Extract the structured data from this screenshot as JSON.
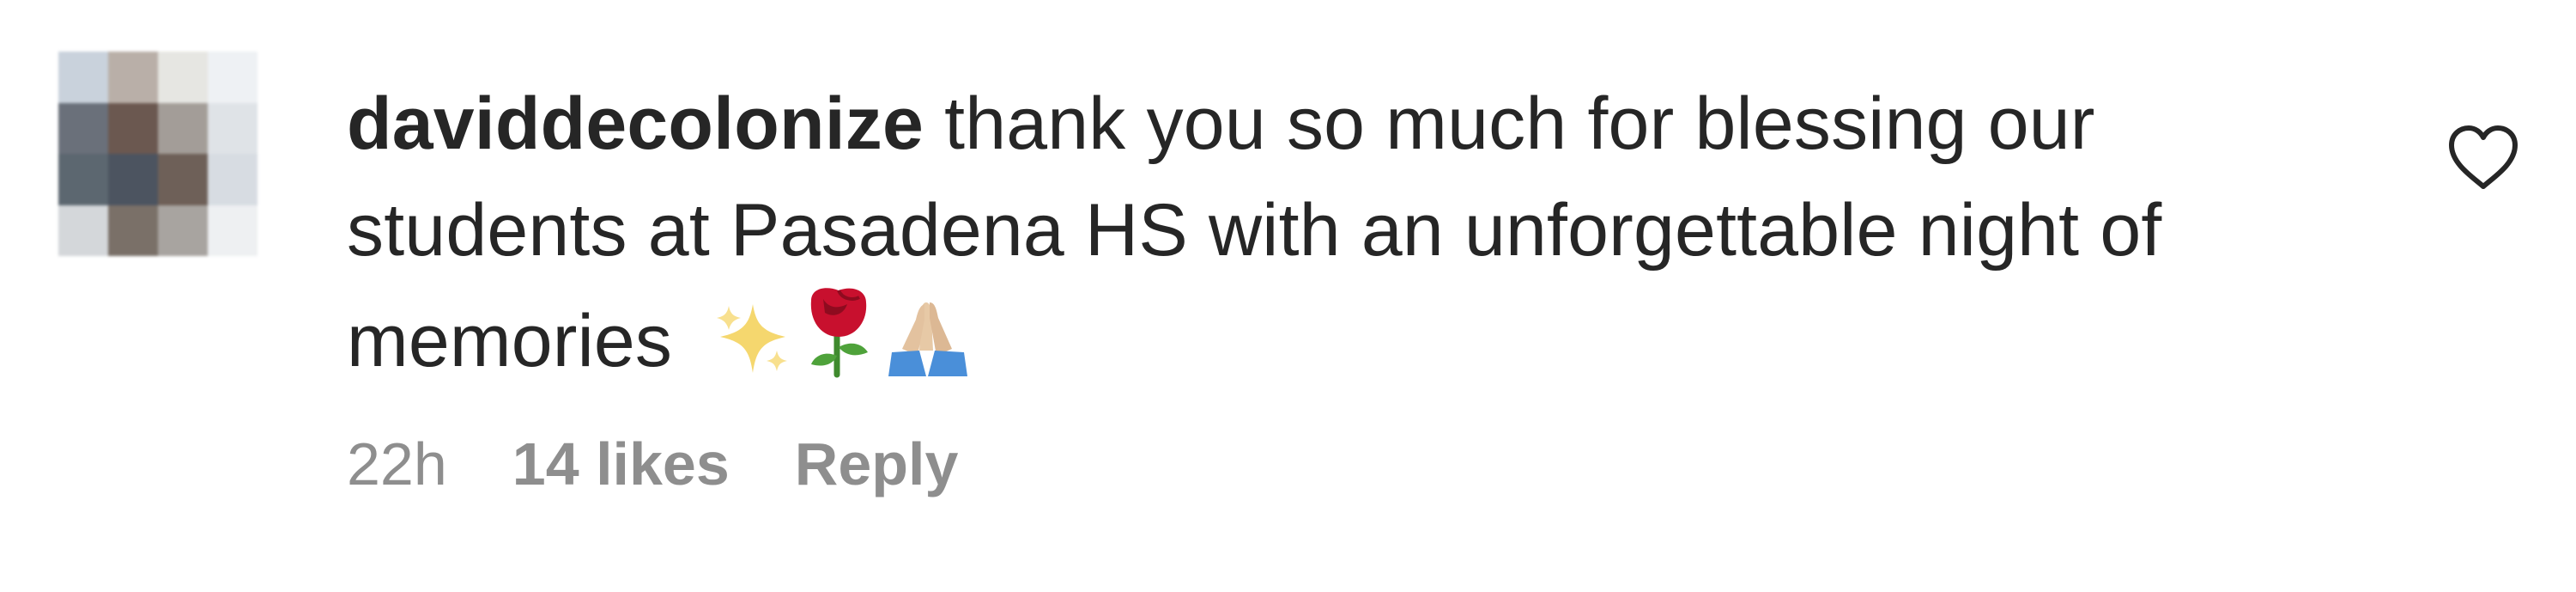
{
  "comment": {
    "username": "daviddecolonize",
    "text": "thank you so much for blessing our students at Pasadena HS with an unforgettable night of memories",
    "emojis": [
      "sparkles-icon",
      "rose-icon",
      "folded-hands-icon"
    ],
    "time": "22h",
    "likes": "14 likes",
    "reply_label": "Reply"
  },
  "avatar_colors": [
    "#c9d2dc",
    "#b9afa8",
    "#e6e6e2",
    "#eef1f4",
    "#6a707a",
    "#6b5850",
    "#a39d98",
    "#dfe3e7",
    "#5c6770",
    "#4c5460",
    "#6e6058",
    "#d7dce2",
    "#d4d7da",
    "#7a7068",
    "#a8a4a0",
    "#eef0f2"
  ]
}
